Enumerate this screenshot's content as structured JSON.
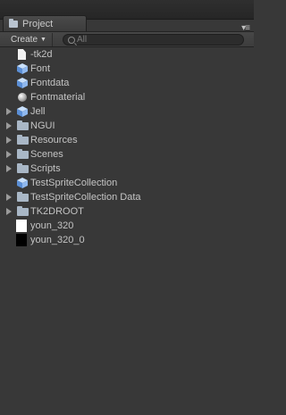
{
  "panel": {
    "tab_label": "Project",
    "menu_glyph": "▾≡"
  },
  "toolbar": {
    "create_label": "Create",
    "search_placeholder": "All"
  },
  "tree": {
    "items": [
      {
        "label": "-tk2d",
        "icon": "document-icon",
        "expandable": false
      },
      {
        "label": "Font",
        "icon": "prefab-cube-icon",
        "expandable": false
      },
      {
        "label": "Fontdata",
        "icon": "prefab-cube-icon",
        "expandable": false
      },
      {
        "label": "Fontmaterial",
        "icon": "material-sphere-icon",
        "expandable": false
      },
      {
        "label": "Jell",
        "icon": "prefab-cube-icon",
        "expandable": true
      },
      {
        "label": "NGUI",
        "icon": "folder-icon",
        "expandable": true
      },
      {
        "label": "Resources",
        "icon": "folder-icon",
        "expandable": true
      },
      {
        "label": "Scenes",
        "icon": "folder-icon",
        "expandable": true
      },
      {
        "label": "Scripts",
        "icon": "folder-icon",
        "expandable": true
      },
      {
        "label": "TestSpriteCollection",
        "icon": "prefab-cube-icon",
        "expandable": false
      },
      {
        "label": "TestSpriteCollection Data",
        "icon": "folder-icon",
        "expandable": true
      },
      {
        "label": "TK2DROOT",
        "icon": "folder-icon",
        "expandable": true
      },
      {
        "label": "youn_320",
        "icon": "white-texture-icon",
        "expandable": false
      },
      {
        "label": "youn_320_0",
        "icon": "black-texture-icon",
        "expandable": false
      }
    ]
  }
}
